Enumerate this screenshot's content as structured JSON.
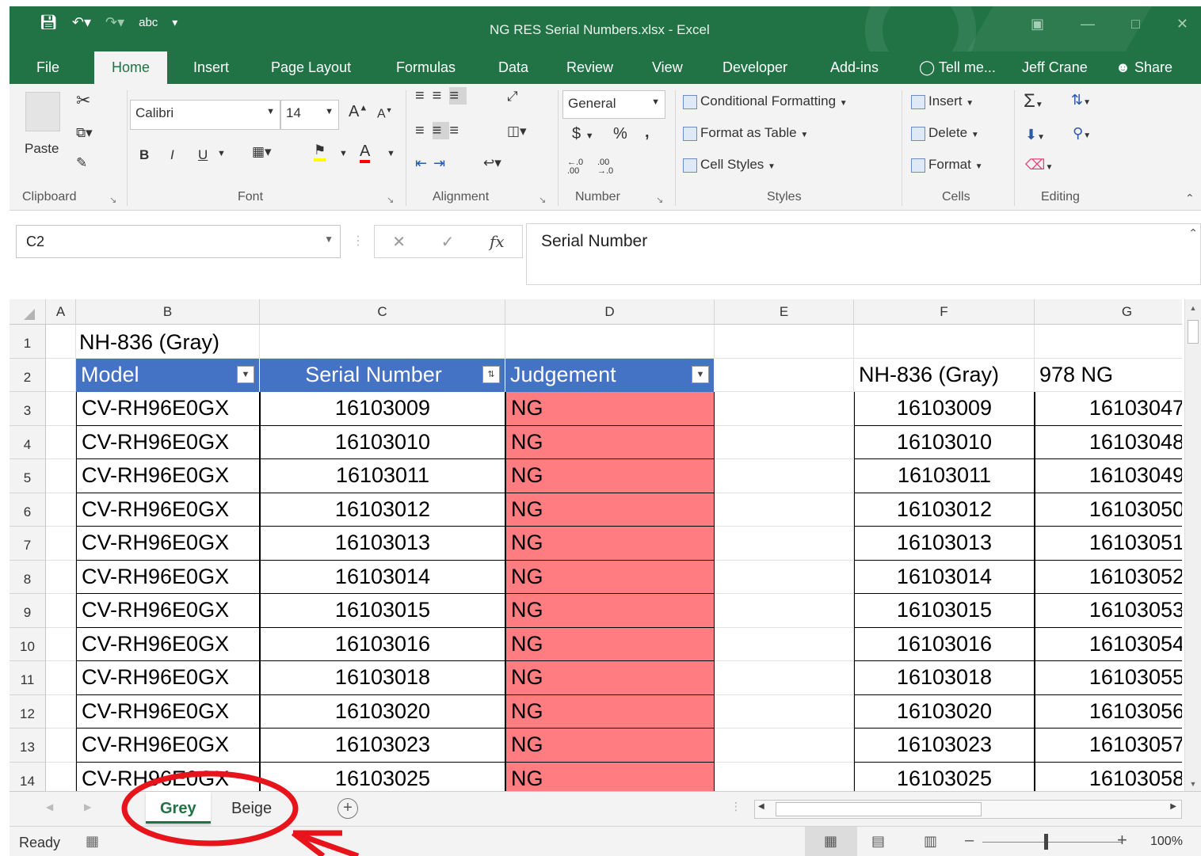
{
  "window": {
    "title": "NG RES Serial Numbers.xlsx - Excel",
    "qat": {
      "save": "save-icon",
      "undo": "undo-icon",
      "redo": "redo-icon",
      "spelling_label": "abc"
    }
  },
  "tabs": [
    "File",
    "Home",
    "Insert",
    "Page Layout",
    "Formulas",
    "Data",
    "Review",
    "View",
    "Developer",
    "Add-ins"
  ],
  "tell_me": "Tell me...",
  "user": "Jeff Crane",
  "share": "Share",
  "ribbon": {
    "clipboard": {
      "paste": "Paste",
      "label": "Clipboard"
    },
    "font": {
      "name": "Calibri",
      "size": "14",
      "bold": "B",
      "italic": "I",
      "underline": "U",
      "grow": "A",
      "shrink": "A",
      "color": "A",
      "label": "Font"
    },
    "alignment": {
      "label": "Alignment"
    },
    "number": {
      "format": "General",
      "currency": "$",
      "percent": "%",
      "comma": ",",
      "inc_dec": "←.0 .00",
      "dec_dec": ".00 →.0",
      "label": "Number"
    },
    "styles": {
      "conditional": "Conditional Formatting",
      "format_table": "Format as Table",
      "cell_styles": "Cell Styles",
      "label": "Styles"
    },
    "cells": {
      "insert": "Insert",
      "delete": "Delete",
      "format": "Format",
      "label": "Cells"
    },
    "editing": {
      "label": "Editing"
    }
  },
  "formula_bar": {
    "name_box": "C2",
    "content": "Serial Number",
    "fx": "fx"
  },
  "columns": [
    "A",
    "B",
    "C",
    "D",
    "E",
    "F",
    "G"
  ],
  "rows": [
    "1",
    "2",
    "3",
    "4",
    "5",
    "6",
    "7",
    "8",
    "9",
    "10",
    "11",
    "12",
    "13",
    "14"
  ],
  "grid": {
    "title": "NH-836 (Gray)",
    "headers": [
      "Model",
      "Serial Number",
      "Judgement"
    ],
    "model": "CV-RH96E0GX",
    "judgement": "NG",
    "serials": [
      "16103009",
      "16103010",
      "16103011",
      "16103012",
      "16103013",
      "16103014",
      "16103015",
      "16103016",
      "16103018",
      "16103020",
      "16103023",
      "16103025"
    ],
    "f_header": "NH-836 (Gray)",
    "g_header": "978 NG",
    "g_values": [
      "16103047",
      "16103048",
      "16103049",
      "16103050",
      "16103051",
      "16103052",
      "16103053",
      "16103054",
      "16103055",
      "16103056",
      "16103057",
      "16103058"
    ]
  },
  "sheet_tabs": [
    "Grey",
    "Beige"
  ],
  "status": {
    "ready": "Ready",
    "zoom": "100%"
  },
  "colors": {
    "excel_green": "#217346",
    "table_header": "#4472c4",
    "ng_fill": "#ff7c80",
    "annotation": "#e8141c"
  }
}
